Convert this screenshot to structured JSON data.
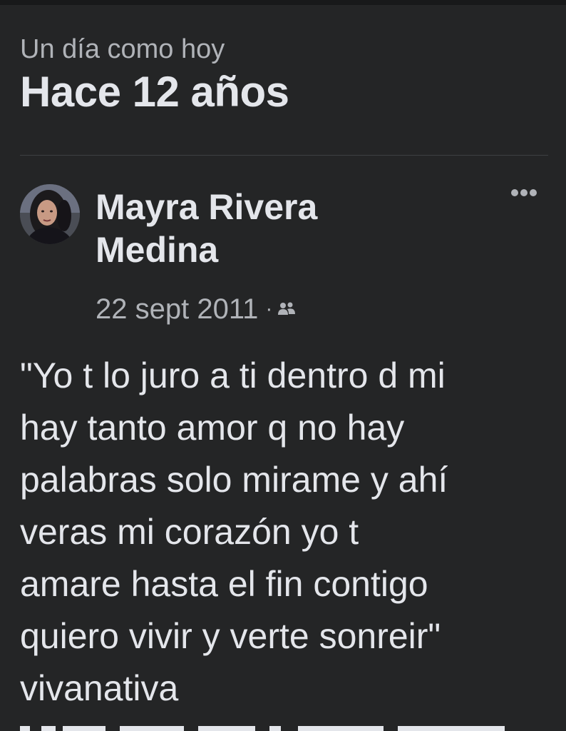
{
  "memory": {
    "subheading": "Un día como hoy",
    "heading": "Hace 12 años"
  },
  "post": {
    "author": "Mayra Rivera\nMedina",
    "date": "22 sept 2011",
    "separator": "·",
    "audience_icon": "friends-icon",
    "more_icon": "more-options-icon",
    "text": "\"Yo t lo juro a ti dentro d mi\nhay tanto amor q no hay\npalabras solo mirame y ahí\nveras mi corazón yo t\namare hasta el fin contigo\nquiero vivir y verte sonreir\"\nvivanativa"
  },
  "colors": {
    "background": "#242526",
    "primary_text": "#e4e6eb",
    "secondary_text": "#b0b3b8",
    "divider": "#3e4042"
  }
}
